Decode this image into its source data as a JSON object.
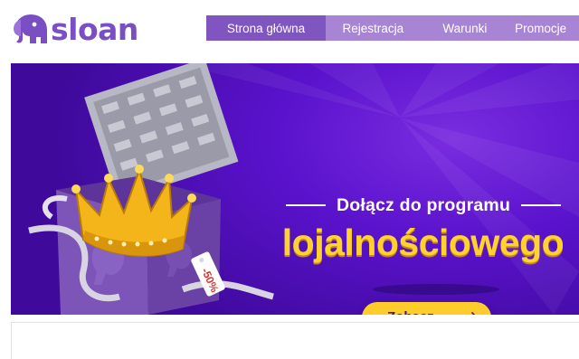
{
  "brand": {
    "name": "sloan",
    "color": "#7b4fc4"
  },
  "nav": {
    "items": [
      {
        "label": "Strona główna",
        "active": true
      },
      {
        "label": "Rejestracja",
        "active": false
      },
      {
        "label": "Warunki",
        "active": false
      },
      {
        "label": "Promocje",
        "active": false
      }
    ],
    "bg_color": "#a885d4",
    "active_color": "#7f55bf"
  },
  "banner": {
    "headline": "Dołącz do programu",
    "highlight": "lojalnościowego",
    "tag_text": "-50%",
    "cta_label": "Zobacz",
    "cta_icon": "arrow-right-icon",
    "highlight_color": "#ffd22e",
    "background_color": "#5a12cc",
    "slides_count": 2
  }
}
